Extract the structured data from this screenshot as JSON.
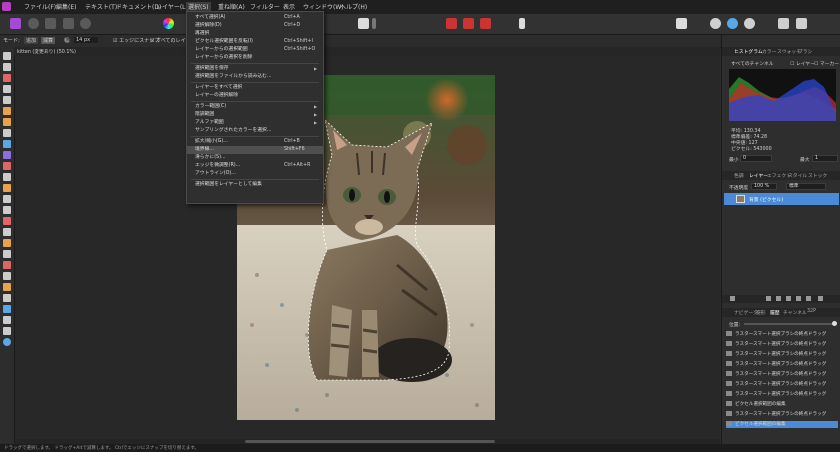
{
  "menubar": {
    "items": [
      "ファイル(F)",
      "編集(E)",
      "テキスト(T)",
      "ドキュメント(D)",
      "レイヤー(L)",
      "選択(S)",
      "重ね順(A)",
      "フィルター",
      "表示",
      "ウィンドウ(W)",
      "ヘルプ(H)"
    ],
    "active_index": 5
  },
  "context_toolbar": {
    "mode_label": "モード:",
    "new_label": "追加",
    "subtract_label": "減算",
    "width_label": "幅:",
    "width_value": "14 px",
    "snap_label": "エッジにスナップ",
    "all_layers_label": "すべてのレイヤー"
  },
  "document_tab": {
    "title": "kitten (変更あり) (50.1%)"
  },
  "select_menu": {
    "groups": [
      [
        {
          "label": "すべて選択(A)",
          "shortcut": "Ctrl+A"
        },
        {
          "label": "選択解除(D)",
          "shortcut": "Ctrl+D"
        },
        {
          "label": "再選択",
          "shortcut": ""
        },
        {
          "label": "ピクセル選択範囲を反転(I)",
          "shortcut": "Ctrl+Shift+I"
        },
        {
          "label": "レイヤーからの選択範囲",
          "shortcut": "Ctrl+Shift+O"
        },
        {
          "label": "レイヤーからの選択を削除",
          "shortcut": ""
        }
      ],
      [
        {
          "label": "選択範囲を保存",
          "shortcut": "",
          "submenu": true
        },
        {
          "label": "選択範囲をファイルから読み込む...",
          "shortcut": ""
        }
      ],
      [
        {
          "label": "レイヤーをすべて選択",
          "shortcut": ""
        },
        {
          "label": "レイヤーの選択解除",
          "shortcut": ""
        }
      ],
      [
        {
          "label": "カラー範囲(C)",
          "shortcut": "",
          "submenu": true
        },
        {
          "label": "階調範囲",
          "shortcut": "",
          "submenu": true
        },
        {
          "label": "アルファ範囲",
          "shortcut": "",
          "submenu": true
        },
        {
          "label": "サンプリングされたカラーを選択...",
          "shortcut": ""
        }
      ],
      [
        {
          "label": "拡大/縮小(G)...",
          "shortcut": "Ctrl+B"
        },
        {
          "label": "境界線...",
          "shortcut": "Shift+F6",
          "highlighted": true
        },
        {
          "label": "滑らかに(S)...",
          "shortcut": ""
        },
        {
          "label": "エッジを微調整(R)...",
          "shortcut": "Ctrl+Alt+R"
        },
        {
          "label": "アウトライン(O)...",
          "shortcut": ""
        }
      ],
      [
        {
          "label": "選択範囲をレイヤーとして編集",
          "shortcut": ""
        }
      ]
    ]
  },
  "histogram_panel": {
    "tabs": [
      "ヒストグラム",
      "カラー",
      "スウォッチ",
      "ブラシ"
    ],
    "channel_select": "すべてのチャンネル",
    "layer_label": "レイヤー",
    "marker_label": "マーカー",
    "stats": [
      "平均: 130.34",
      "標準偏差: 74.28",
      "中央値: 127",
      "ピクセル: 543000"
    ],
    "min_label": "最小",
    "min_value": "0",
    "max_label": "最大",
    "max_value": "1"
  },
  "layers_panel": {
    "tabs": [
      "色調",
      "レイヤー",
      "エフェクト",
      "スタイル",
      "ストック"
    ],
    "opacity_label": "不透明度",
    "opacity_value": "100 %",
    "blend_mode": "標準",
    "layer_name": "背景",
    "layer_type": "(ピクセル)"
  },
  "history_panel": {
    "tabs": [
      "ナビゲーター",
      "変形",
      "履歴",
      "チャンネル",
      "32P"
    ],
    "position_label": "位置:",
    "items": [
      "ラスタースマート選択ブラシの終点ドラッグ",
      "ラスタースマート選択ブラシの終点ドラッグ",
      "ラスタースマート選択ブラシの終点ドラッグ",
      "ラスタースマート選択ブラシの終点ドラッグ",
      "ラスタースマート選択ブラシの終点ドラッグ",
      "ラスタースマート選択ブラシの終点ドラッグ",
      "ラスタースマート選択ブラシの終点ドラッグ",
      "ピクセル選択範囲の編集",
      "ラスタースマート選択ブラシの終点ドラッグ",
      "ピクセル選択範囲の編集"
    ],
    "selected_index": 9
  },
  "status_bar": {
    "text": "ドラッグで選択します。 ドラッグ+Altで減算します。 Ctrlでエッジにスナップを切り替えます。"
  },
  "colors": {
    "accent": "#4a8ad6",
    "menu_highlight": "#4f4f4f",
    "background": "#2a2a2a"
  }
}
